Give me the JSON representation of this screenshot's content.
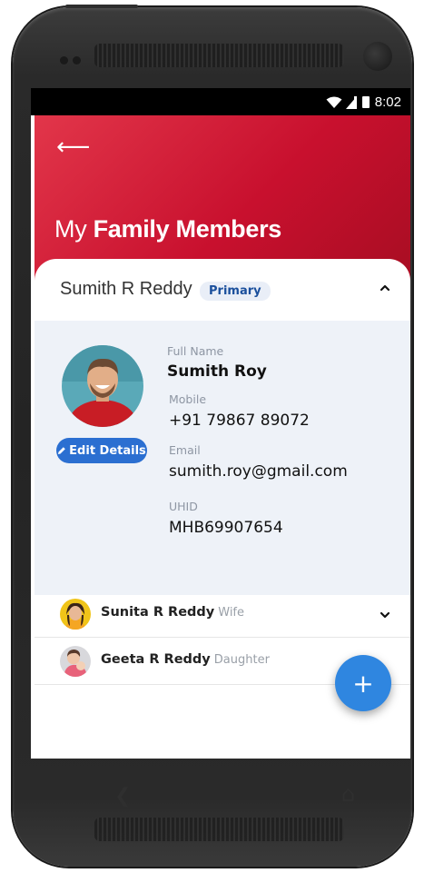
{
  "status_bar": {
    "time": "8:02"
  },
  "header": {
    "back_icon": "back-arrow-icon",
    "title_light": "My",
    "title_bold": "Family Members"
  },
  "primary_member": {
    "name": "Sumith R Reddy",
    "badge": "Primary",
    "edit_label": "Edit Details",
    "fields": {
      "full_name_label": "Full Name",
      "full_name_value": "Sumith Roy",
      "mobile_label": "Mobile",
      "mobile_value": "+91 79867 89072",
      "email_label": "Email",
      "email_value": "sumith.roy@gmail.com",
      "uhid_label": "UHID",
      "uhid_value": "MHB69907654"
    }
  },
  "members": [
    {
      "name": "Sunita R Reddy",
      "relation": "Wife"
    },
    {
      "name": "Geeta R Reddy",
      "relation": "Daughter"
    }
  ],
  "fab": {
    "label": "+"
  },
  "colors": {
    "header_red": "#c8102e",
    "accent_blue": "#2b6fd1",
    "panel_bg": "#eef2f8"
  }
}
